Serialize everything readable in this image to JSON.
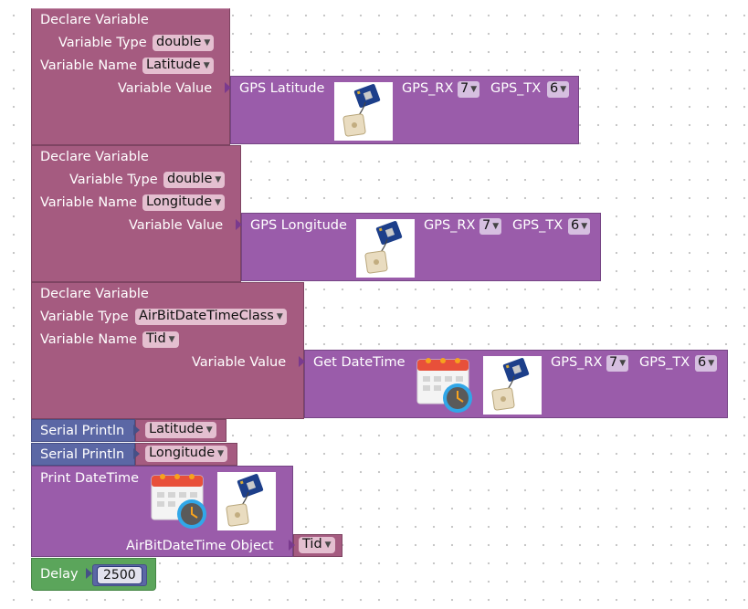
{
  "blocks": {
    "declare1": {
      "title": "Declare Variable",
      "type_label": "Variable Type",
      "type_value": "double",
      "name_label": "Variable Name",
      "name_value": "Latitude",
      "value_label": "Variable Value",
      "source_label": "GPS Latitude",
      "rx_label": "GPS_RX",
      "rx_value": "7",
      "tx_label": "GPS_TX",
      "tx_value": "6"
    },
    "declare2": {
      "title": "Declare Variable",
      "type_label": "Variable Type",
      "type_value": "double",
      "name_label": "Variable Name",
      "name_value": "Longitude",
      "value_label": "Variable Value",
      "source_label": "GPS Longitude",
      "rx_label": "GPS_RX",
      "rx_value": "7",
      "tx_label": "GPS_TX",
      "tx_value": "6"
    },
    "declare3": {
      "title": "Declare Variable",
      "type_label": "Variable Type",
      "type_value": "AirBitDateTimeClass",
      "name_label": "Variable Name",
      "name_value": "Tid",
      "value_label": "Variable Value",
      "source_label": "Get DateTime",
      "rx_label": "GPS_RX",
      "rx_value": "7",
      "tx_label": "GPS_TX",
      "tx_value": "6"
    },
    "println1": {
      "label": "Serial Println",
      "value": "Latitude"
    },
    "println2": {
      "label": "Serial Println",
      "value": "Longitude"
    },
    "printdt": {
      "label": "Print DateTime",
      "object_label": "AirBitDateTime Object",
      "object_value": "Tid"
    },
    "delay": {
      "label": "Delay",
      "value": "2500"
    }
  },
  "icons": [
    "gps-module-icon",
    "calendar-clock-icon",
    "dropdown-arrow-icon"
  ],
  "dropdown_arrow": "▼",
  "colors": {
    "variable_block": "#a55b80",
    "gps_block": "#9a5caa",
    "serial_block": "#5b67a5",
    "delay_block": "#5ba55b",
    "canvas": "#ffffff"
  }
}
